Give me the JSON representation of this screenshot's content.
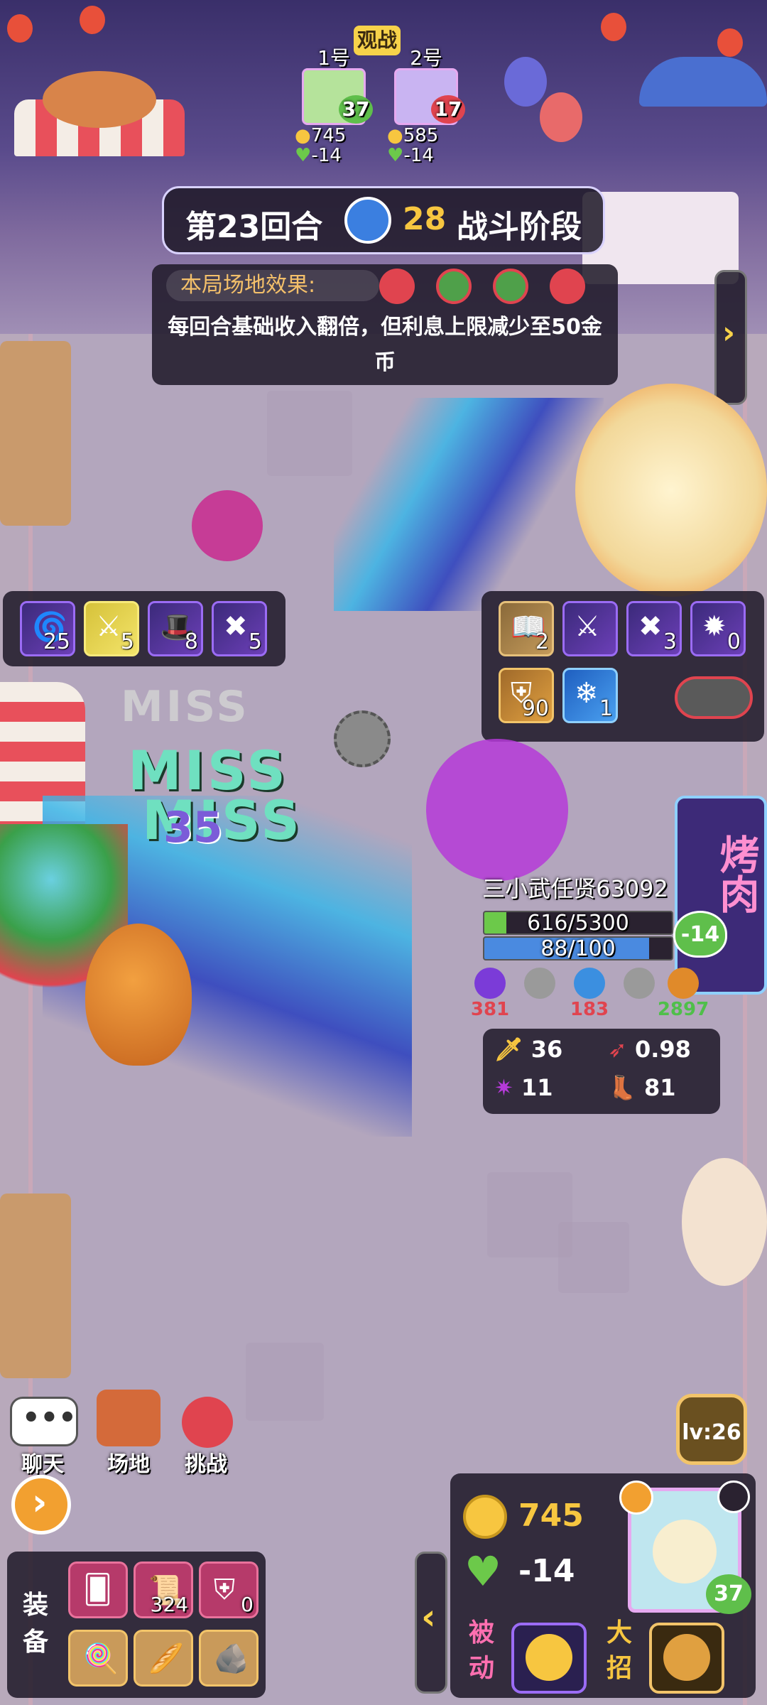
{
  "spectate": {
    "label": "观战"
  },
  "players": [
    {
      "slot": "1号",
      "level": "37",
      "gold": "745",
      "hp": "-14"
    },
    {
      "slot": "2号",
      "level": "17",
      "gold": "585",
      "hp": "-14"
    }
  ],
  "round_banner": {
    "round": "第23回合",
    "timer": "28",
    "phase": "战斗阶段"
  },
  "field_effect": {
    "label": "本局场地效果:",
    "text": "每回合基础收入翻倍，但利息上限减少至50金币"
  },
  "left_skills": [
    {
      "icon": "swirl-skill-icon",
      "count": "25"
    },
    {
      "icon": "sword-skill-icon",
      "count": "5"
    },
    {
      "icon": "wizard-hat-skill-icon",
      "count": "8"
    },
    {
      "icon": "crossed-swords-skill-icon",
      "count": "5"
    }
  ],
  "right_skills": [
    {
      "icon": "book-skill-icon",
      "count": "2"
    },
    {
      "icon": "sword-skill-icon",
      "count": ""
    },
    {
      "icon": "crossed-swords-skill-icon",
      "count": "3"
    },
    {
      "icon": "explosion-skill-icon",
      "count": "0"
    },
    {
      "icon": "shield-skill-icon",
      "count": "90"
    },
    {
      "icon": "snowflake-skill-icon",
      "count": "1"
    }
  ],
  "battle_text": {
    "miss1": "MISS",
    "miss2": "MISS",
    "miss3": "MISS",
    "damage": "35"
  },
  "enemy": {
    "name": "三小武任贤63092",
    "hp_text": "616/5300",
    "hp_fraction": 0.116,
    "mana_text": "88/100",
    "mana_fraction": 0.88,
    "heart_value": "-14",
    "resists": [
      {
        "icon": "skull-icon",
        "value": "381",
        "color": "#e0444f"
      },
      {
        "icon": "leaf-icon",
        "value": "",
        "color": "#888888"
      },
      {
        "icon": "snowflake-icon",
        "value": "183",
        "color": "#e0444f"
      },
      {
        "icon": "fire-icon",
        "value": "",
        "color": "#888888"
      },
      {
        "icon": "shield-icon",
        "value": "2897",
        "color": "#4fbf4a"
      }
    ],
    "stats": {
      "attack": "36",
      "crit": "0.98",
      "magic": "11",
      "speed": "81"
    }
  },
  "sign_text": "烤肉",
  "actions": {
    "chat": "聊天",
    "field": "场地",
    "challenge": "挑战"
  },
  "equipment": {
    "label": "装备",
    "items": [
      {
        "icon": "card-icon",
        "count": ""
      },
      {
        "icon": "scroll-icon",
        "count": "324"
      },
      {
        "icon": "heal-shield-icon",
        "count": "0"
      },
      {
        "icon": "lollipop-icon",
        "count": ""
      },
      {
        "icon": "bread-icon",
        "count": ""
      },
      {
        "icon": "rock-icon",
        "count": ""
      }
    ]
  },
  "player_panel": {
    "gold": "745",
    "hp": "-14",
    "level_badge": "lv:26",
    "avatar_level": "37",
    "passive_label": "被动",
    "ultimate_label": "大招"
  },
  "colors": {
    "gold": "#f7c640",
    "heart": "#6cc94a",
    "panel": "#1e1828",
    "accent": "#9b6cf5"
  }
}
